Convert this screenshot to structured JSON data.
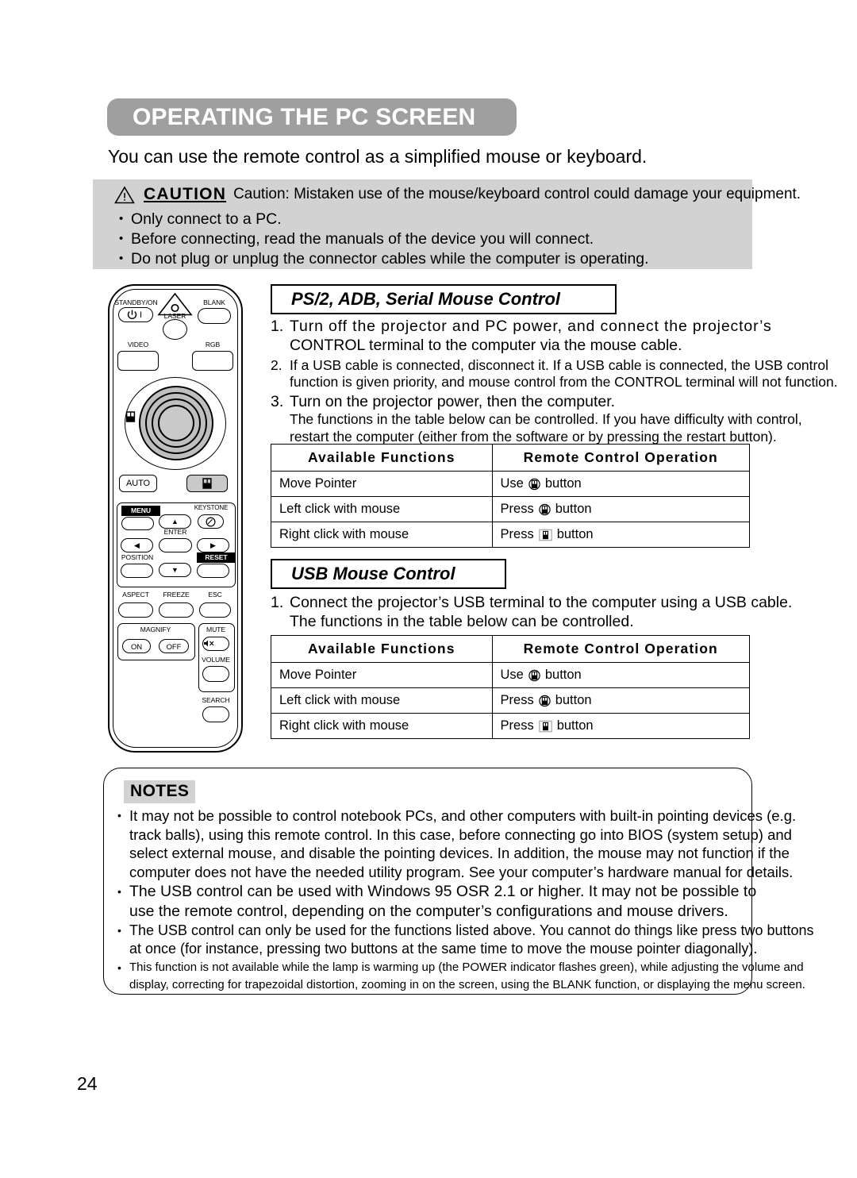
{
  "page": {
    "title": "OPERATING THE PC SCREEN",
    "intro": "You can use the remote control as a simplified mouse or keyboard.",
    "page_number": "24",
    "banner_color": "#9f9f9f",
    "caution_bg": "#d2d2d2"
  },
  "caution": {
    "icon": "warning-triangle-icon",
    "word": "CAUTION",
    "text": "Caution: Mistaken use of the mouse/keyboard control could damage your equipment.",
    "bullets": [
      "Only connect to a PC.",
      "Before connecting, read the manuals of the device you will connect.",
      "Do not plug or unplug the connector cables while the computer is operating."
    ]
  },
  "remote": {
    "labels": {
      "standby": "STANDBY/ON",
      "laser": "LASER",
      "blank": "BLANK",
      "video": "VIDEO",
      "rgb": "RGB",
      "auto": "AUTO",
      "menu": "MENU",
      "keystone": "KEYSTONE",
      "enter": "ENTER",
      "position": "POSITION",
      "reset": "RESET",
      "aspect": "ASPECT",
      "freeze": "FREEZE",
      "esc": "ESC",
      "magnify": "MAGNIFY",
      "on": "ON",
      "off": "OFF",
      "mute": "MUTE",
      "volume": "VOLUME",
      "search": "SEARCH",
      "power_glyph": "⏻ I",
      "up_glyph": "▲",
      "down_glyph": "▼",
      "left_glyph": "◀",
      "right_glyph": "▶"
    }
  },
  "ps2_section": {
    "heading": "PS/2, ADB, Serial Mouse Control",
    "steps": [
      {
        "num": "1.",
        "lines": [
          "Turn off the projector and PC power, and connect the projector’s",
          "CONTROL terminal to the computer via the mouse cable."
        ]
      },
      {
        "num": "2.",
        "lines": [
          "If a USB cable is connected, disconnect it. If a USB cable is connected, the USB control",
          "function is given priority, and mouse control from the CONTROL terminal will not function."
        ]
      },
      {
        "num": "3.",
        "lines": [
          "Turn on the projector power, then the computer."
        ],
        "sub_lines": [
          "The functions in the table below can be controlled. If you have difficulty with control,",
          "restart the computer (either from the software or by pressing the restart button)."
        ]
      }
    ],
    "table": {
      "headers": [
        "Available Functions",
        "Remote Control Operation"
      ],
      "rows": [
        {
          "function": "Move Pointer",
          "prefix": "Use",
          "icon": "disc-mouse-icon",
          "suffix": "button"
        },
        {
          "function": "Left click with mouse",
          "prefix": "Press",
          "icon": "disc-mouse-icon",
          "suffix": "button"
        },
        {
          "function": "Right click with mouse",
          "prefix": "Press",
          "icon": "mouse-button-icon",
          "suffix": "button"
        }
      ]
    }
  },
  "usb_section": {
    "heading": "USB Mouse Control",
    "steps": [
      {
        "num": "1.",
        "lines": [
          "Connect the projector’s USB terminal to the computer using a USB cable.",
          "The functions in the table below can be controlled."
        ]
      }
    ],
    "table": {
      "headers": [
        "Available Functions",
        "Remote Control Operation"
      ],
      "rows": [
        {
          "function": "Move Pointer",
          "prefix": "Use",
          "icon": "disc-mouse-icon",
          "suffix": "button"
        },
        {
          "function": "Left click with mouse",
          "prefix": "Press",
          "icon": "disc-mouse-icon",
          "suffix": "button"
        },
        {
          "function": "Right click with mouse",
          "prefix": "Press",
          "icon": "mouse-button-icon",
          "suffix": "button"
        }
      ]
    }
  },
  "notes": {
    "label": "NOTES",
    "items": [
      [
        "It may not be possible to control notebook PCs, and other computers with built-in pointing devices (e.g.",
        "track balls), using this remote control. In this case, before connecting go into BIOS (system setup) and",
        "select external mouse, and disable the pointing devices. In addition, the mouse may not function if the",
        "computer does not have the needed utility program. See your computer’s hardware manual for details."
      ],
      [
        "The USB control can be used with Windows 95 OSR 2.1 or higher. It may not be possible to",
        "use the remote control, depending on the computer’s configurations and mouse drivers."
      ],
      [
        "The USB control can only be used for the functions listed above. You cannot do things like press two buttons",
        "at once (for instance, pressing two buttons at the same time to move the mouse pointer diagonally)."
      ],
      [
        "This function is not available while the lamp is warming up (the POWER indicator flashes green), while adjusting the volume and",
        "display, correcting for trapezoidal distortion, zooming in on the screen, using the BLANK function, or displaying the menu screen."
      ]
    ]
  }
}
